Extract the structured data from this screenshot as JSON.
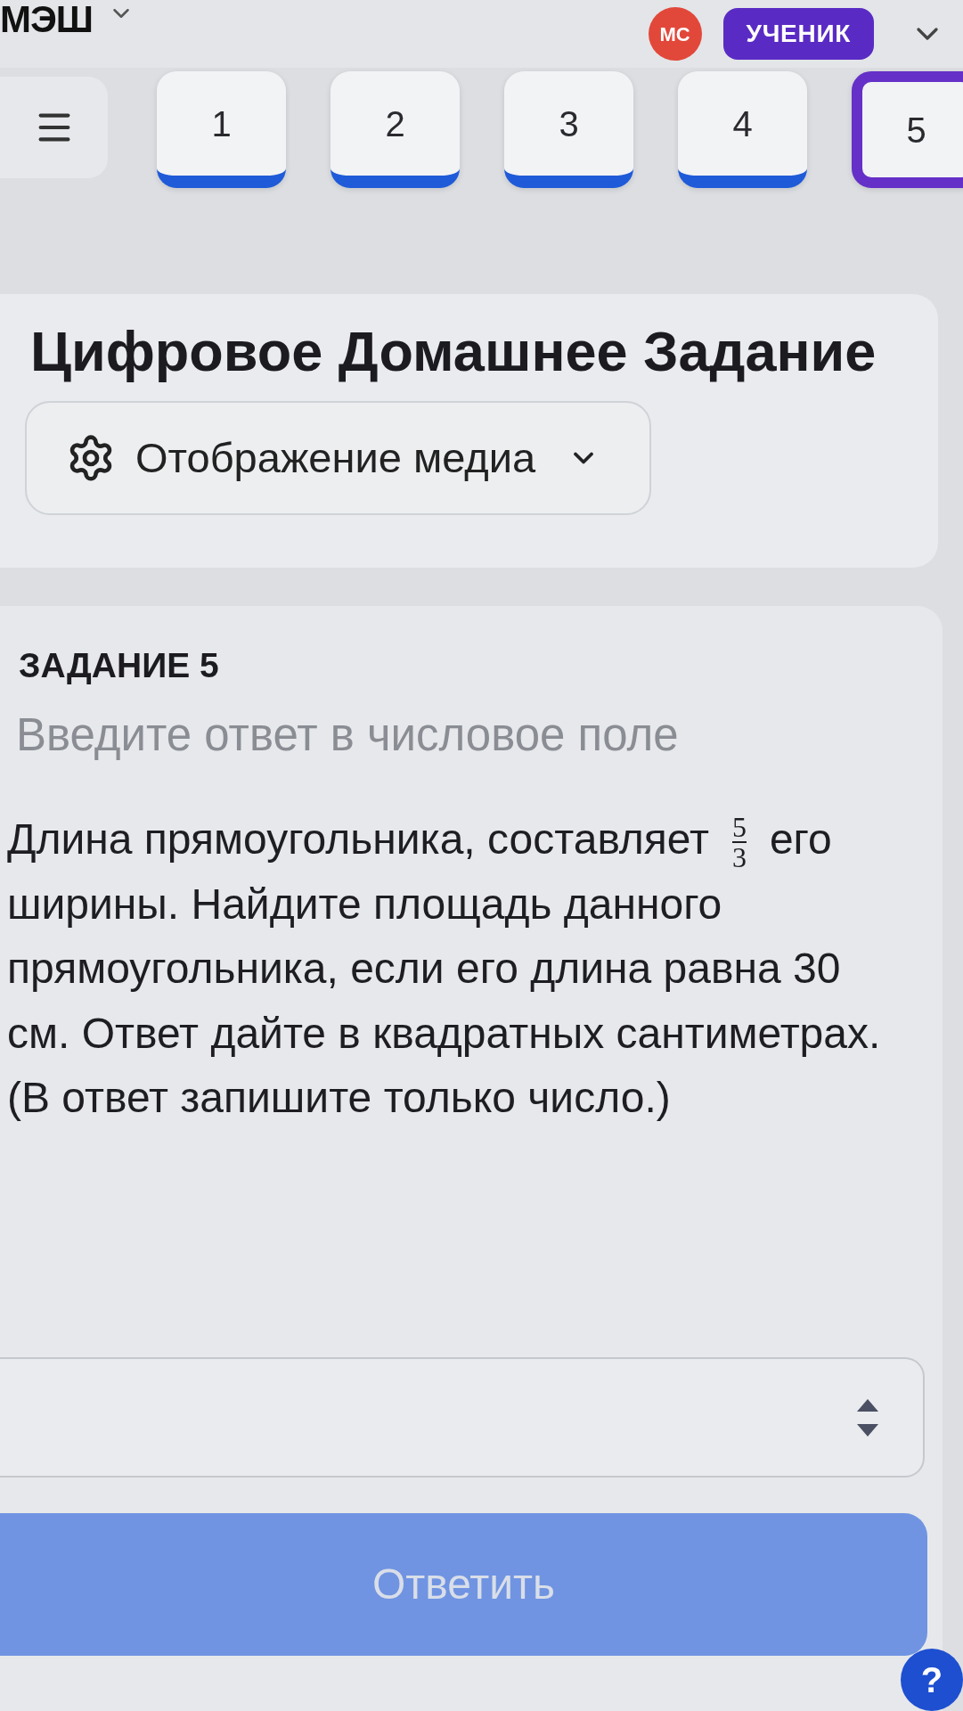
{
  "header": {
    "logo": "МЭШ",
    "avatar_initials": "МС",
    "role": "УЧЕНИК"
  },
  "task_tabs": [
    {
      "label": "1",
      "selected": false,
      "answered": true
    },
    {
      "label": "2",
      "selected": false,
      "answered": true
    },
    {
      "label": "3",
      "selected": false,
      "answered": true
    },
    {
      "label": "4",
      "selected": false,
      "answered": true
    },
    {
      "label": "5",
      "selected": true,
      "answered": false
    }
  ],
  "homework": {
    "title": "Цифровое Домашнее Задание",
    "media_dropdown": {
      "label": "Отображение медиа",
      "expanded": false
    }
  },
  "task": {
    "heading": "ЗАДАНИЕ 5",
    "instruction": "Введите ответ в числовое поле",
    "question": {
      "before": "Длина прямоугольника, составляет",
      "fraction": {
        "numerator": "5",
        "denominator": "3"
      },
      "after": "его ширины. Найдите площадь данного прямоугольника, если его длина равна 30 см. Ответ дайте в квадратных сантиметрах. (В ответ запишите только число.)"
    },
    "answer_field": {
      "kind": "number"
    },
    "submit_button": {
      "label": "Ответить",
      "disabled": true
    }
  },
  "help_button": {
    "label": "?"
  }
}
